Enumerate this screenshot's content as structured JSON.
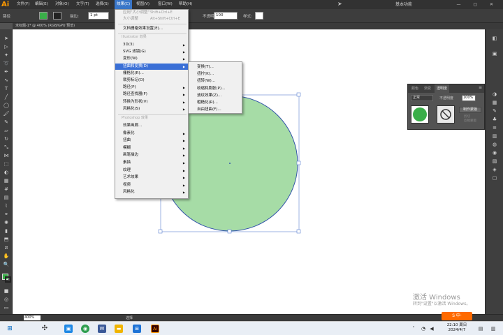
{
  "app": {
    "logo": "Ai"
  },
  "menubar": {
    "items": [
      "文件(F)",
      "编辑(E)",
      "对象(O)",
      "文字(T)",
      "选择(S)",
      "效果(C)",
      "视图(V)",
      "窗口(W)",
      "帮助(H)"
    ],
    "active_index": 5,
    "workspace": "基本功能"
  },
  "control": {
    "path_label": "路径",
    "fill_color": "#3aae49",
    "stroke_label": "描边:",
    "stroke_value": "1 pt",
    "style_label": "样式:",
    "opacity_label": "不透明度",
    "opacity_value": "100"
  },
  "document": {
    "tab_title": "未标题-1* @ 400% (RGB/GPU 预览)"
  },
  "effect_menu": {
    "top_items": [
      {
        "label": "应用\"大小调整\"",
        "shortcut": "Shift+Ctrl+E",
        "disabled": true
      },
      {
        "label": "大小调整",
        "shortcut": "Alt+Shift+Ctrl+E",
        "disabled": true
      }
    ],
    "doc_raster": "文档栅格效果设置(E)...",
    "illustrator_header": "Illustrator 效果",
    "illustrator_items": [
      "3D(3)",
      "SVG 滤镜(G)",
      "变形(W)",
      "扭曲和变换(D)",
      "栅格化(R)...",
      "裁剪标记(O)",
      "路径(P)",
      "路径查找器(F)",
      "转换为形状(V)",
      "风格化(S)"
    ],
    "illustrator_arrows": [
      true,
      true,
      true,
      true,
      false,
      false,
      true,
      true,
      true,
      true
    ],
    "highlight_index": 3,
    "photoshop_header": "Photoshop 效果",
    "photoshop_items": [
      "效果画廊...",
      "像素化",
      "扭曲",
      "模糊",
      "画笔描边",
      "素描",
      "纹理",
      "艺术效果",
      "视频",
      "风格化"
    ],
    "photoshop_arrows": [
      false,
      true,
      true,
      true,
      true,
      true,
      true,
      true,
      true,
      true
    ]
  },
  "submenu": {
    "items": [
      "变换(T)...",
      "扭拧(K)...",
      "扭转(W)...",
      "收缩和膨胀(P)...",
      "波纹效果(Z)...",
      "粗糙化(R)...",
      "自由扭曲(F)..."
    ]
  },
  "transparency_panel": {
    "tabs": [
      "颜色",
      "渐变",
      "透明度"
    ],
    "active_tab": 2,
    "blend_mode": "正常",
    "opacity_label": "不透明度",
    "opacity_value": "100%",
    "make_mask": "制作蒙版",
    "clip": "剪切",
    "invert": "反相蒙版"
  },
  "circle": {
    "fill": "#a6dca6",
    "stroke": "#3355aa"
  },
  "status": {
    "zoom": "400%",
    "tool": "选择"
  },
  "taskbar": {
    "time": "22:10 周日",
    "date": "2024/4/7"
  },
  "watermark": {
    "line1": "激活 Windows",
    "line2": "转到\"设置\"以激活 Windows。"
  }
}
